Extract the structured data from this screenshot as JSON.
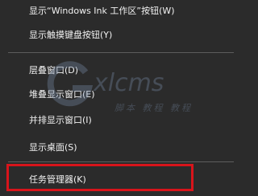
{
  "menu": {
    "items": [
      {
        "label": "显示“Windows Ink 工作区”按钮(W)"
      },
      {
        "label": "显示触摸键盘按钮(Y)"
      },
      {
        "label": "层叠窗口(D)"
      },
      {
        "label": "堆叠显示窗口(E)"
      },
      {
        "label": "并排显示窗口(I)"
      },
      {
        "label": "显示桌面(S)"
      },
      {
        "label": "任务管理器(K)"
      }
    ]
  },
  "watermark": {
    "main": "xlcms",
    "sub": "脚本 教程 教程"
  },
  "colors": {
    "background": "#2b2b2b",
    "text": "#f2f2f2",
    "separator": "#5d5d5d",
    "highlight": "#d8141b"
  }
}
